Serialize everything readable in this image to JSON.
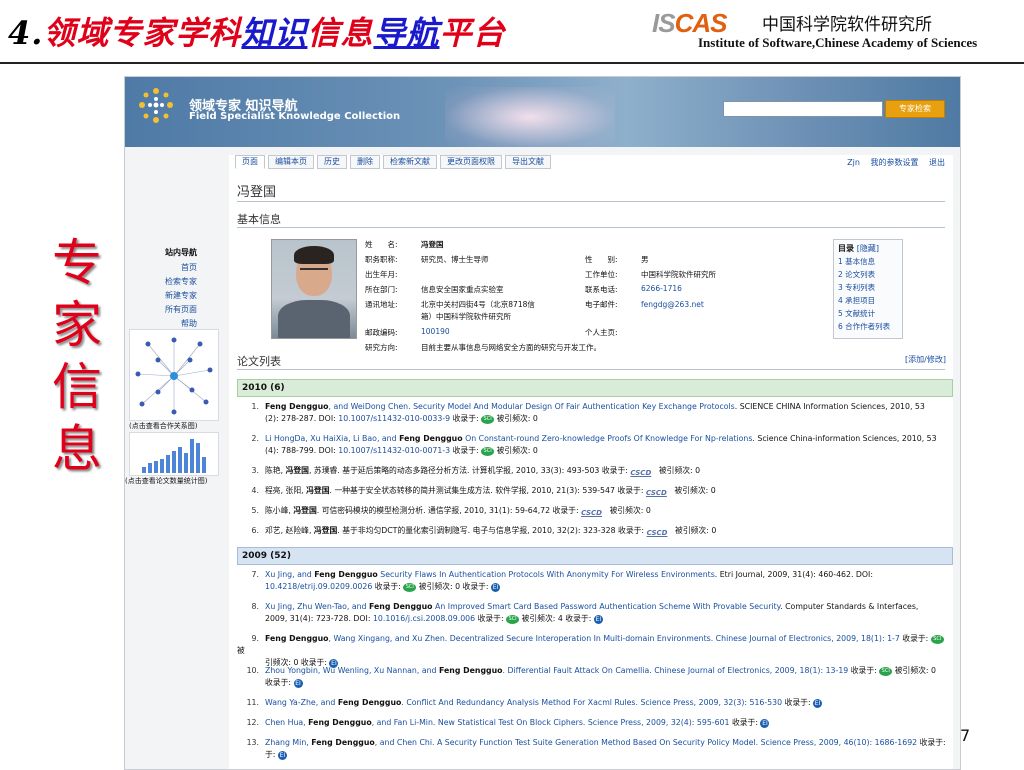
{
  "slide": {
    "number": "4.",
    "title_part1": "领域专家学科",
    "title_part2": "知识",
    "title_part3": "信息",
    "title_part4": "导航",
    "title_part5": "平台",
    "side_label": [
      "专",
      "家",
      "信",
      "息"
    ],
    "page_number": "7"
  },
  "logo": {
    "mark_part1": "IS",
    "mark_part2": "CAS",
    "cn": "中国科学院软件研究所",
    "en": "Institute of Software,Chinese Academy of Sciences"
  },
  "banner": {
    "title_cn": "领域专家 知识导航",
    "title_en": "Field Specialist Knowledge Collection",
    "search_button": "专家检索"
  },
  "left_nav": {
    "title": "站内导航",
    "items": [
      "首页",
      "检索专家",
      "新建专家",
      "所有页面",
      "帮助"
    ],
    "coauthor_caption": "(点击查看合作关系图)",
    "stats_caption": "(点击查看论文数量统计图)"
  },
  "tabs": [
    "页面",
    "编辑本页",
    "历史",
    "删除",
    "检索新文献",
    "更改页面权限",
    "导出文献"
  ],
  "user_links": {
    "user": "Zjn",
    "settings": "我的参数设置",
    "logout": "退出"
  },
  "person": {
    "name": "冯登国",
    "basic_info_heading": "基本信息",
    "labels": {
      "name": "姓　　名:",
      "title": "职务职称:",
      "birth": "出生年月:",
      "dept": "所在部门:",
      "address": "通讯地址:",
      "zipcode": "邮政编码:",
      "research": "研究方向:",
      "gender": "性　　别:",
      "employer": "工作单位:",
      "phone": "联系电话:",
      "email": "电子邮件:",
      "homepage": "个人主页:"
    },
    "values": {
      "name": "冯登国",
      "title": "研究员、博士生导师",
      "birth": "",
      "dept": "信息安全国家重点实验室",
      "address_1": "北京中关村四街4号（北京8718信",
      "address_2": "箱）中国科学院软件研究所",
      "zipcode": "100190",
      "research": "目前主要从事信息与网络安全方面的研究与开发工作。",
      "gender": "男",
      "employer": "中国科学院软件研究所",
      "phone": "6266-1716",
      "email": "fengdg@263.net",
      "homepage": ""
    }
  },
  "toc": {
    "title": "目录",
    "hide": "[隐藏]",
    "items": [
      "1 基本信息",
      "2 论文列表",
      "3 专利列表",
      "4 承担项目",
      "5 文献统计",
      "6 合作作者列表"
    ]
  },
  "papers": {
    "heading": "论文列表",
    "add_edit": "[添加/修改]",
    "year_2010": "2010 (6)",
    "year_2009": "2009 (52)",
    "sci_badge": "SCI",
    "csdb_badge": "CSCD",
    "ei_badge": "EI",
    "items": [
      {
        "idx": "1.",
        "authors": "Feng Dengguo",
        "authors_rest": ", and WeiDong Chen.",
        "title": "Security Model And Modular Design Of Fair Authentication Key Exchange Protocols",
        "venue": ". SCIENCE CHINA Information Sciences, 2010, 53",
        "line2": "(2): 278-287. DOI:",
        "doi": "10.1007/s11432-010-0033-9",
        "tail": "收录于:",
        "cite": "被引频次: 0"
      },
      {
        "idx": "2.",
        "authors_pre": "Li HongDa, Xu HaiXia, Li Bao, and",
        "authors": "Feng Dengguo",
        "title": "On Constant-round Zero-knowledge Proofs Of Knowledge For Np-relations",
        "venue": ". Science China-information Sciences, 2010, 53",
        "line2": "(4): 788-799. DOI:",
        "doi": "10.1007/s11432-010-0071-3",
        "tail": "收录于:",
        "cite": "被引频次: 0"
      },
      {
        "idx": "3.",
        "authors_pre": "陈艳,",
        "authors": "冯登国",
        "authors_rest": ", 苏璞睿",
        "title": ". 基于延后策略的动态多路径分析方法. 计算机学报, 2010, 33(3): 493-503",
        "tail": "收录于:",
        "cite": "被引频次: 0"
      },
      {
        "idx": "4.",
        "authors_pre": "程亮, 张阳,",
        "authors": "冯登国",
        "title": ". 一种基于安全状态转移的简并测试集生成方法. 软件学报, 2010, 21(3): 539-547",
        "tail": "收录于:",
        "cite": "被引频次: 0"
      },
      {
        "idx": "5.",
        "authors_pre": "陈小峰,",
        "authors": "冯登国",
        "title": ". 可信密码模块的模型检测分析. 通信学报, 2010, 31(1): 59-64,72",
        "tail": "收录于:",
        "cite": "被引频次: 0"
      },
      {
        "idx": "6.",
        "authors_pre": "邓艺, 赵险峰,",
        "authors": "冯登国",
        "title": ". 基于非均匀DCT的量化索引调制隐写. 电子与信息学报, 2010, 32(2): 323-328",
        "tail": "收录于:",
        "cite": "被引频次: 0"
      },
      {
        "idx": "7.",
        "authors_pre": "Xu Jing, and",
        "authors": "Feng Dengguo",
        "title": "Security Flaws In Authentication Protocols With Anonymity For Wireless Environments",
        "venue": ". Etri Journal, 2009, 31(4): 460-462. DOI:",
        "doi": "10.4218/etrij.09.0209.0026",
        "tail": "收录于:",
        "cite": "被引频次: 0 收录于:"
      },
      {
        "idx": "8.",
        "authors_pre": "Xu Jing, Zhu Wen-Tao, and",
        "authors": "Feng Dengguo",
        "title": "An Improved Smart Card Based Password Authentication Scheme With Provable Security",
        "venue": ". Computer Standards & Interfaces,",
        "line2": "2009, 31(4): 723-728. DOI:",
        "doi": "10.1016/j.csi.2008.09.006",
        "tail": "收录于:",
        "cite": "被引频次: 4 收录于:"
      },
      {
        "idx": "9.",
        "authors": "Feng Dengguo",
        "authors_rest": ", Wang Xingang, and Xu Zhen.",
        "title": "Decentralized Secure Interoperation In Multi-domain Environments. Chinese Journal of Electronics, 2009, 18(1): 1-7",
        "tail": "收录于:",
        "line2": "引频次: 0 收录于:",
        "cite": "被"
      },
      {
        "idx": "10.",
        "authors_pre": "Zhou Yongbin, Wu Wenling, Xu Nannan, and",
        "authors": "Feng Dengguo",
        "title": ". Differential Fault Attack On Camellia. Chinese Journal of Electronics, 2009, 18(1): 13-19",
        "tail": "收录于:",
        "cite": "被引频次: 0",
        "line2": "收录于:"
      },
      {
        "idx": "11.",
        "authors_pre": "Wang Ya-Zhe, and",
        "authors": "Feng Dengguo",
        "title": ". Conflict And Redundancy Analysis Method For Xacml Rules. Science Press, 2009, 32(3): 516-530",
        "tail": "收录于:"
      },
      {
        "idx": "12.",
        "authors_pre": "Chen Hua,",
        "authors": "Feng Dengguo",
        "authors_rest": ", and Fan Li-Min.",
        "title": "New Statistical Test On Block Ciphers. Science Press, 2009, 32(4): 595-601",
        "tail": "收录于:"
      },
      {
        "idx": "13.",
        "authors_pre": "Zhang Min,",
        "authors": "Feng Dengguo",
        "authors_rest": ", and Chen Chi.",
        "title": "A Security Function Test Suite Generation Method Based On Security Policy Model. Science Press, 2009, 46(10): 1686-1692",
        "tail": "收录于:",
        "line2": "于:"
      }
    ]
  }
}
